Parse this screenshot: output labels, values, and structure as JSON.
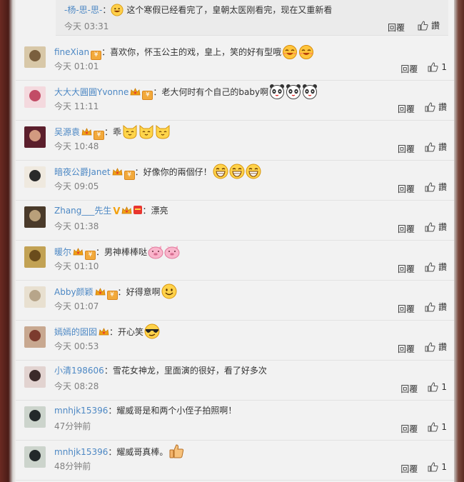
{
  "top_reply": {
    "user": "-杨-思-思-",
    "sep": "：",
    "text": "这个寒假已经看完了，皇朝太医刚看完，现在又重新看",
    "time": "今天 03:31",
    "reply": "回覆",
    "like": "讚"
  },
  "comments": [
    {
      "user": "fineXian",
      "text": "喜欢你，怀玉公主的戏，皇上，笑的好有型哦",
      "time": "今天 01:01",
      "reply": "回覆",
      "like": "1",
      "emotes": [
        "laugh-cat",
        "laugh-cat"
      ],
      "badges": [
        "fin"
      ],
      "avatar": [
        "#d8c8a8",
        "#7a5f3e"
      ]
    },
    {
      "user": "大大大圓圓Yvonne",
      "text": "老大何时有个自己的baby啊",
      "time": "今天 11:11",
      "reply": "回覆",
      "like": "讚",
      "emotes": [
        "panda",
        "panda",
        "panda"
      ],
      "badges": [
        "crown",
        "fin"
      ],
      "avatar": [
        "#f4d9de",
        "#c24c66"
      ]
    },
    {
      "user": "吴源袁",
      "text": "乖",
      "time": "今天 10:48",
      "reply": "回覆",
      "like": "讚",
      "emotes": [
        "cat",
        "cat",
        "cat"
      ],
      "badges": [
        "crown",
        "fin"
      ],
      "avatar": [
        "#5b1f2c",
        "#d29a80"
      ]
    },
    {
      "user": "暗夜公爵Janet",
      "text": "好像你的兩個仔！",
      "time": "今天 09:05",
      "reply": "回覆",
      "like": "讚",
      "emotes": [
        "grin",
        "grin",
        "grin"
      ],
      "badges": [
        "crown",
        "fin"
      ],
      "avatar": [
        "#efe9df",
        "#2a2a2a"
      ]
    },
    {
      "user": "Zhang___先生",
      "text": "漂亮",
      "time": "今天 01:38",
      "reply": "回覆",
      "like": "讚",
      "emotes": [],
      "badges": [
        "v",
        "crown",
        "red"
      ],
      "avatar": [
        "#4a3a2a",
        "#b9a07a"
      ]
    },
    {
      "user": "暖尔",
      "text": "男神棒棒哒",
      "time": "今天 01:10",
      "reply": "回覆",
      "like": "讚",
      "emotes": [
        "pig",
        "pig"
      ],
      "badges": [
        "crown",
        "fin"
      ],
      "avatar": [
        "#c2a254",
        "#6a4c1c"
      ]
    },
    {
      "user": "Abby颜颖",
      "text": "好得意啊",
      "time": "今天 01:07",
      "reply": "回覆",
      "like": "讚",
      "emotes": [
        "smile"
      ],
      "badges": [
        "crown",
        "fin"
      ],
      "avatar": [
        "#e8e0d0",
        "#b7a58a"
      ]
    },
    {
      "user": "嫣嫣的囡囡",
      "text": "开心笑",
      "time": "今天 00:53",
      "reply": "回覆",
      "like": "讚",
      "emotes": [
        "cool"
      ],
      "badges": [
        "crown"
      ],
      "avatar": [
        "#c8a890",
        "#7c3b2e"
      ]
    },
    {
      "user": "小清198606",
      "text": "雪花女神龙，里面演的很好，看了好多次",
      "time": "今天 08:28",
      "reply": "回覆",
      "like": "1",
      "emotes": [],
      "badges": [],
      "avatar": [
        "#e2d3d0",
        "#3b2a2a"
      ]
    },
    {
      "user": "mnhjk15396",
      "text": "耀威哥是和两个小侄子拍照啊！",
      "time": "47分钟前",
      "reply": "回覆",
      "like": "1",
      "emotes": [],
      "badges": [],
      "avatar": [
        "#ccd4cc",
        "#23282a"
      ]
    },
    {
      "user": "mnhjk15396",
      "text": "耀威哥真棒。",
      "time": "48分钟前",
      "reply": "回覆",
      "like": "1",
      "emotes": [
        "thumb"
      ],
      "badges": [],
      "avatar": [
        "#ccd4cc",
        "#23282a"
      ]
    }
  ],
  "colors": {
    "username": "#4d88c4",
    "time": "#808080",
    "badge_orange": "#f2a93b",
    "background": "#f2f2f2"
  }
}
